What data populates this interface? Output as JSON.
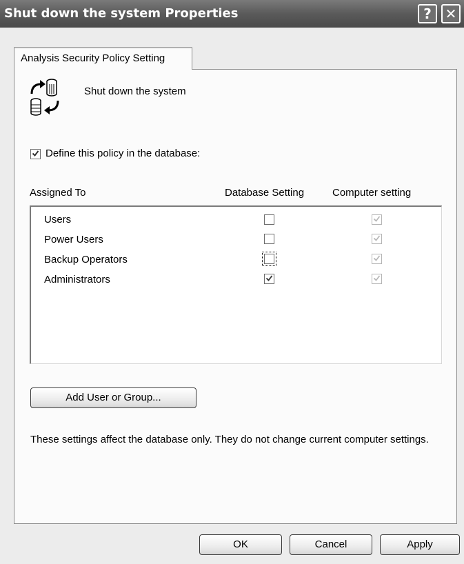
{
  "window": {
    "title": "Shut down the system Properties",
    "help_glyph": "?",
    "close_glyph": "✕"
  },
  "tab": {
    "label": "Analysis Security Policy Setting"
  },
  "policy": {
    "name": "Shut down the system",
    "icon": "database-sync-icon"
  },
  "define": {
    "label": "Define this policy in the database:",
    "checked": true
  },
  "columns": {
    "assigned_to": "Assigned To",
    "database_setting": "Database Setting",
    "computer_setting": "Computer setting"
  },
  "rows": [
    {
      "label": "Users",
      "database": false,
      "computer": true
    },
    {
      "label": "Power Users",
      "database": false,
      "computer": true
    },
    {
      "label": "Backup Operators",
      "database": false,
      "computer": true,
      "focused": true
    },
    {
      "label": "Administrators",
      "database": true,
      "computer": true
    }
  ],
  "buttons": {
    "add_user": "Add User or Group...",
    "ok": "OK",
    "cancel": "Cancel",
    "apply": "Apply"
  },
  "info": "These settings affect the database only. They do not change current computer settings.",
  "colors": {
    "titlebar": "#5a5a5a",
    "panel": "#fbfbfb",
    "background": "#ececec"
  }
}
